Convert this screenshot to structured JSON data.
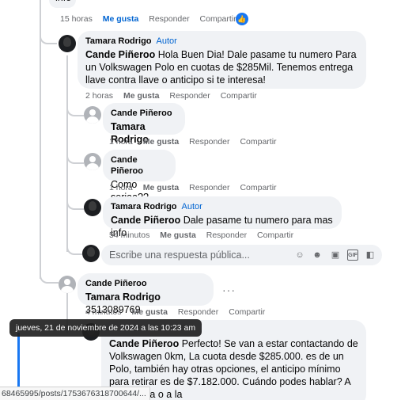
{
  "top_comment": {
    "text_fragment": "info",
    "time": "15 horas",
    "like": "Me gusta",
    "reply": "Responder",
    "share": "Compartir",
    "liked_icon": "thumbs-up-icon"
  },
  "reply_1": {
    "author": "Tamara Rodrigo",
    "tag": "Autor",
    "mention": "Cande Piñeroo",
    "text": " Hola Buen Dia! Dale pasame tu numero Para un Volkswagen Polo en cuotas de $285Mil. Tenemos entrega llave contra llave o anticipo si te interesa!",
    "time": "2 horas",
    "like": "Me gusta",
    "reply": "Responder",
    "share": "Compartir"
  },
  "reply_2": {
    "author": "Cande Piñeroo",
    "mention": "Tamara Rodrigo",
    "time": "1 hora",
    "like": "Me gusta",
    "reply": "Responder",
    "share": "Compartir"
  },
  "reply_3": {
    "author": "Cande Piñeroo",
    "text": "Como seriaa??",
    "time": "1 hora",
    "like": "Me gusta",
    "reply": "Responder",
    "share": "Compartir"
  },
  "reply_4": {
    "author": "Tamara Rodrigo",
    "tag": "Autor",
    "mention": "Cande Piñeroo",
    "text": " Dale pasame tu numero para mas info",
    "time": "54 minutos",
    "like": "Me gusta",
    "reply": "Responder",
    "share": "Compartir"
  },
  "reply_input": {
    "placeholder": "Escribe una respuesta pública...",
    "icons": [
      "avatar-sticker-icon",
      "emoji-icon",
      "camera-icon",
      "gif-icon",
      "sticker-icon"
    ]
  },
  "reply_5": {
    "author": "Cande Piñeroo",
    "mention": "Tamara Rodrigo",
    "text": " 3513089769",
    "time": "4 minutos",
    "like": "Me gusta",
    "reply": "Responder",
    "share": "Compartir"
  },
  "tooltip": "jueves, 21 de noviembre de 2024 a las 10:23 am",
  "reply_6": {
    "mention": "Cande Piñeroo",
    "text": " Perfecto! Se van a estar contactando de Volkswagen 0km, La cuota desde $285.000. es de un Polo, también hay otras opciones, el anticipo mínimo para retirar es de $7.182.000. Cuándo podes hablar? A la mañana o a la"
  },
  "status_url": "68465995/posts/1753676318700644/..."
}
